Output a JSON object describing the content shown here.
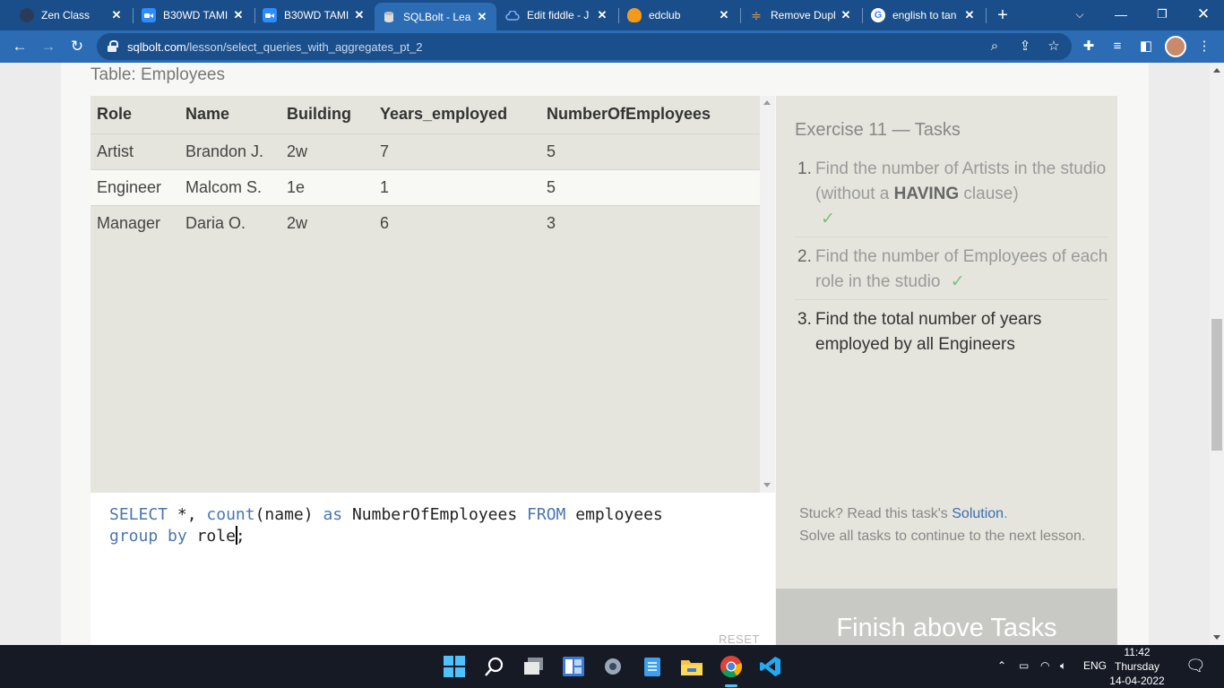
{
  "browser": {
    "tabs": [
      {
        "title": "Zen Class",
        "active": false
      },
      {
        "title": "B30WD TAMI",
        "active": false
      },
      {
        "title": "B30WD TAMI",
        "active": false
      },
      {
        "title": "SQLBolt - Lea",
        "active": true
      },
      {
        "title": "Edit fiddle - J",
        "active": false
      },
      {
        "title": "edclub",
        "active": false
      },
      {
        "title": "Remove Dupl",
        "active": false
      },
      {
        "title": "english to tan",
        "active": false
      }
    ],
    "url_host": "sqlbolt.com",
    "url_path": "/lesson/select_queries_with_aggregates_pt_2"
  },
  "table": {
    "caption": "Table: Employees",
    "columns": [
      "Role",
      "Name",
      "Building",
      "Years_employed",
      "NumberOfEmployees"
    ],
    "rows": [
      [
        "Artist",
        "Brandon J.",
        "2w",
        "7",
        "5"
      ],
      [
        "Engineer",
        "Malcom S.",
        "1e",
        "1",
        "5"
      ],
      [
        "Manager",
        "Daria O.",
        "2w",
        "6",
        "3"
      ]
    ]
  },
  "editor": {
    "line1": {
      "kw1": "SELECT",
      "t1": " *, ",
      "fn": "count",
      "t2": "(name) ",
      "kw2": "as",
      "t3": " NumberOfEmployees ",
      "kw3": "FROM",
      "t4": " employees"
    },
    "line2": {
      "kw1": "group",
      "t1": " ",
      "kw2": "by",
      "t2": " role",
      "t3": ";"
    },
    "reset_label": "RESET"
  },
  "exercise": {
    "title": "Exercise 11 — Tasks",
    "tasks": [
      {
        "num": "1.",
        "pre": "Find the number of Artists in the studio (without a ",
        "bold": "HAVING",
        "post": " clause)",
        "done": true
      },
      {
        "num": "2.",
        "text": "Find the number of Employees of each role in the studio",
        "done": true
      },
      {
        "num": "3.",
        "text": "Find the total number of years employed by all Engineers",
        "done": false
      }
    ],
    "check_mark": "✓",
    "help_prefix": "Stuck? Read this task's ",
    "help_link": "Solution",
    "help_suffix": ".",
    "help_line2": "Solve all tasks to continue to the next lesson.",
    "finish_label": "Finish above Tasks"
  },
  "taskbar": {
    "lang": "ENG",
    "time": "11:42",
    "day": "Thursday",
    "date": "14-04-2022"
  }
}
